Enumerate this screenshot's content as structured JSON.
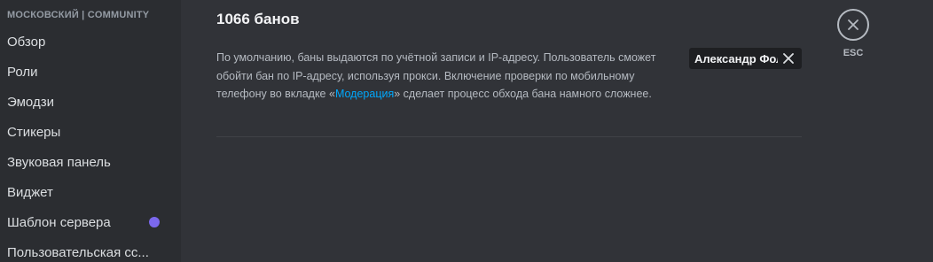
{
  "sidebar": {
    "header": "МОСКОВСКИЙ | COMMUNITY",
    "items": [
      {
        "label": "Обзор"
      },
      {
        "label": "Роли"
      },
      {
        "label": "Эмодзи"
      },
      {
        "label": "Стикеры"
      },
      {
        "label": "Звуковая панель"
      },
      {
        "label": "Виджет"
      },
      {
        "label": "Шаблон сервера",
        "badge_color": "#7b68ee"
      },
      {
        "label": "Пользовательская сс..."
      }
    ]
  },
  "main": {
    "title": "1066 банов",
    "description": {
      "before_link": "По умолчанию, баны выдаются по учётной записи и IP-адресу. Пользователь сможет обойти бан по IP-адресу, используя прокси. Включение проверки по мобильному телефону во вкладке «",
      "link": "Модерация",
      "after_link": "» сделает процесс обхода бана намного сложнее."
    },
    "search": {
      "value": "Александр Фол",
      "clear_icon": "close-icon"
    },
    "close": {
      "icon": "close-icon",
      "label": "ESC"
    }
  },
  "colors": {
    "background": "#313338",
    "sidebar": "#2b2d31",
    "link": "#00a8fc",
    "badge": "#7b68ee"
  }
}
